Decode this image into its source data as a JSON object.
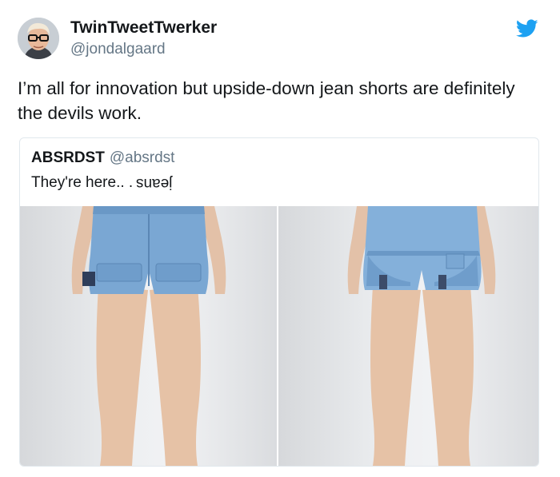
{
  "tweet": {
    "display_name": "TwinTweetTwerker",
    "handle": "@jondalgaard",
    "text": "I’m all for innovation but upside-down jean shorts are definitely the devils work."
  },
  "quoted_tweet": {
    "display_name": "ABSRDST",
    "handle": "@absrdst",
    "text": "They're here.. .",
    "flipped_text": "jeans"
  },
  "icons": {
    "brand": "twitter-bird-icon",
    "avatar": "user-avatar"
  },
  "colors": {
    "twitter_blue": "#1da1f2",
    "text_primary": "#14171a",
    "text_secondary": "#657786",
    "border": "#e1e8ed",
    "denim": "#7aa7d3"
  }
}
